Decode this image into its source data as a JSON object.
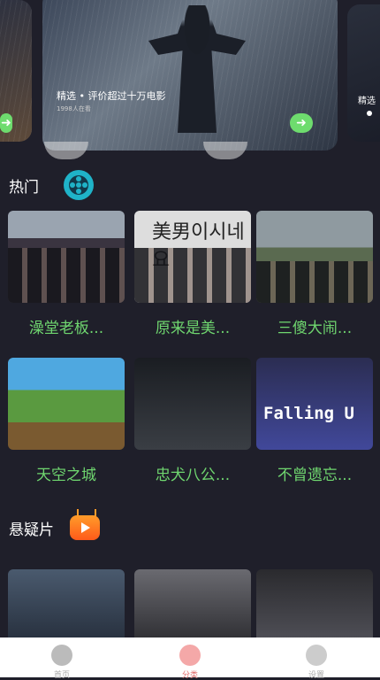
{
  "banner": {
    "caption": "精选 • 评价超过十万电影",
    "sub": "1998人在看",
    "right_caption": "精选"
  },
  "sections": [
    {
      "title": "热门",
      "icon": "film-reel-icon"
    },
    {
      "title": "悬疑片",
      "icon": "tv-play-icon"
    }
  ],
  "hot": [
    {
      "label": "澡堂老板...",
      "poster_text": ""
    },
    {
      "label": "原来是美...",
      "poster_text": "美男이시네요"
    },
    {
      "label": "三傻大闹...",
      "poster_text": ""
    },
    {
      "label": "天空之城",
      "poster_text": ""
    },
    {
      "label": "忠犬八公...",
      "poster_text": ""
    },
    {
      "label": "不曾遗忘...",
      "poster_text": "Falling U"
    }
  ],
  "tabs": [
    {
      "label": "首页",
      "icon": "home-icon"
    },
    {
      "label": "分类",
      "icon": "crown-icon"
    },
    {
      "label": "设置",
      "icon": "gear-icon"
    }
  ]
}
